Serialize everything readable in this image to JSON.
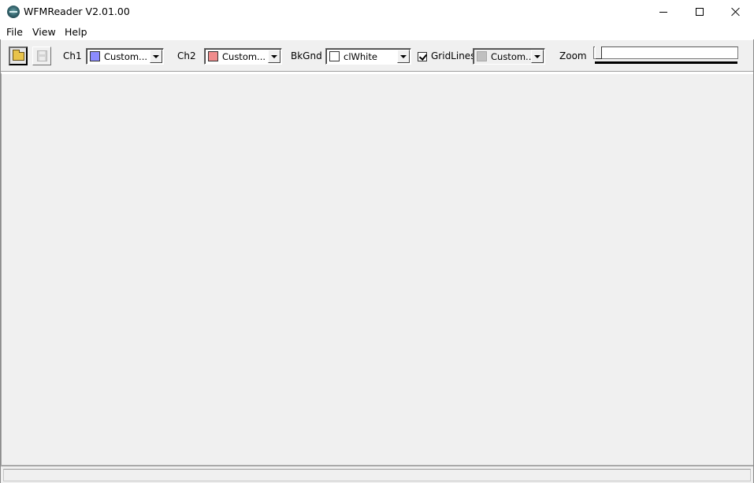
{
  "window": {
    "title": "WFMReader V2.01.00"
  },
  "menu": {
    "items": [
      "File",
      "View",
      "Help"
    ]
  },
  "toolbar": {
    "ch1": {
      "label": "Ch1",
      "value": "Custom...",
      "color": "#8c8cff"
    },
    "ch2": {
      "label": "Ch2",
      "value": "Custom...",
      "color": "#f08c8c"
    },
    "bkgnd": {
      "label": "BkGnd",
      "value": "clWhite",
      "color": "#ffffff"
    },
    "gridlines": {
      "label": "GridLines",
      "checked": true,
      "value": "Custom...",
      "color": "#c0c0c0"
    },
    "zoom": {
      "label": "Zoom",
      "level": 0
    }
  }
}
